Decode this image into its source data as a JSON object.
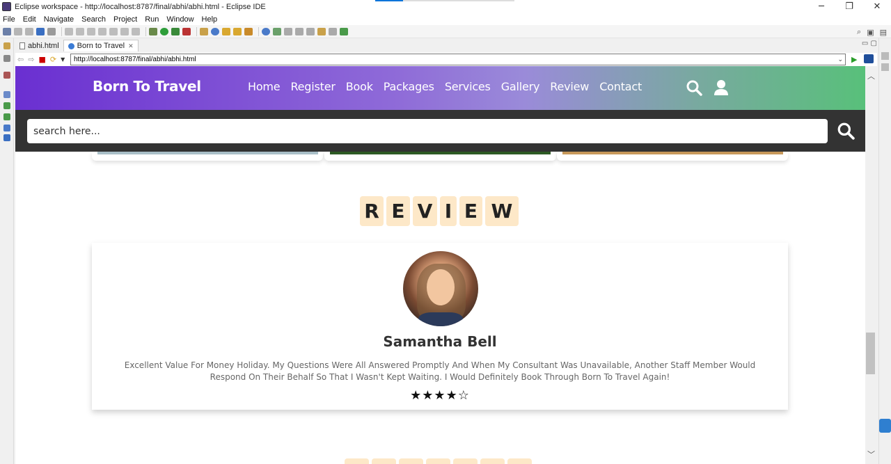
{
  "window": {
    "title": "Eclipse workspace - http://localhost:8787/final/abhi/abhi.html - Eclipse IDE",
    "minimize": "─",
    "restore": "❐",
    "close": "✕"
  },
  "menu": [
    "File",
    "Edit",
    "Navigate",
    "Search",
    "Project",
    "Run",
    "Window",
    "Help"
  ],
  "editor_tabs": [
    {
      "label": "abhi.html"
    },
    {
      "label": "Born to Travel",
      "close": "✕"
    }
  ],
  "browser": {
    "url": "http://localhost:8787/final/abhi/abhi.html"
  },
  "site": {
    "logo": "Born To Travel",
    "nav": [
      "Home",
      "Register",
      "Book",
      "Packages",
      "Services",
      "Gallery",
      "Review",
      "Contact"
    ],
    "search_placeholder": "search here...",
    "review_heading": [
      "R",
      "E",
      "V",
      "I",
      "E",
      "W"
    ],
    "review": {
      "name": "Samantha Bell",
      "text": "Excellent Value For Money Holiday. My Questions Were All Answered Promptly And When My Consultant Was Unavailable, Another Staff Member Would Respond On Their Behalf So That I Wasn't Kept Waiting. I Would Definitely Book Through Born To Travel Again!",
      "rating": 4,
      "rating_max": 5,
      "stars": "★★★★☆"
    }
  },
  "colors": {
    "header_gradient_start": "#6a2fd1",
    "header_gradient_end": "#58c07a",
    "search_strip": "#333333",
    "heading_tile": "#fde8c8"
  }
}
